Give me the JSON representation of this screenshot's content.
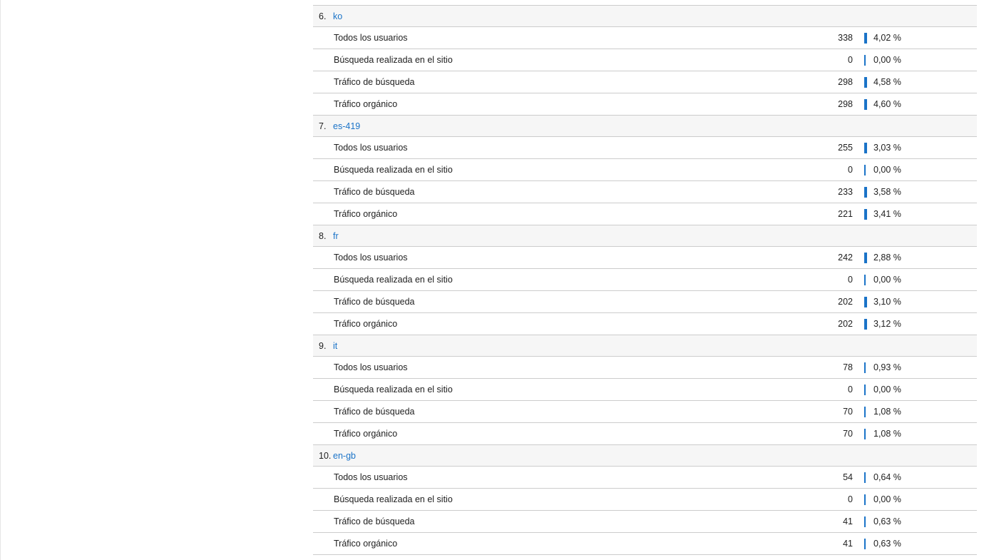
{
  "colors": {
    "accent": "#1a73c8",
    "header_bg": "#f6f6f6",
    "border": "#cccccc"
  },
  "groups": [
    {
      "index": "6.",
      "label": "ko",
      "rows": [
        {
          "label": "Todos los usuarios",
          "value": "338",
          "percent": "4,02 %",
          "pct": 4.02
        },
        {
          "label": "Búsqueda realizada en el sitio",
          "value": "0",
          "percent": "0,00 %",
          "pct": 0
        },
        {
          "label": "Tráfico de búsqueda",
          "value": "298",
          "percent": "4,58 %",
          "pct": 4.58
        },
        {
          "label": "Tráfico orgánico",
          "value": "298",
          "percent": "4,60 %",
          "pct": 4.6
        }
      ]
    },
    {
      "index": "7.",
      "label": "es-419",
      "rows": [
        {
          "label": "Todos los usuarios",
          "value": "255",
          "percent": "3,03 %",
          "pct": 3.03
        },
        {
          "label": "Búsqueda realizada en el sitio",
          "value": "0",
          "percent": "0,00 %",
          "pct": 0
        },
        {
          "label": "Tráfico de búsqueda",
          "value": "233",
          "percent": "3,58 %",
          "pct": 3.58
        },
        {
          "label": "Tráfico orgánico",
          "value": "221",
          "percent": "3,41 %",
          "pct": 3.41
        }
      ]
    },
    {
      "index": "8.",
      "label": "fr",
      "rows": [
        {
          "label": "Todos los usuarios",
          "value": "242",
          "percent": "2,88 %",
          "pct": 2.88
        },
        {
          "label": "Búsqueda realizada en el sitio",
          "value": "0",
          "percent": "0,00 %",
          "pct": 0
        },
        {
          "label": "Tráfico de búsqueda",
          "value": "202",
          "percent": "3,10 %",
          "pct": 3.1
        },
        {
          "label": "Tráfico orgánico",
          "value": "202",
          "percent": "3,12 %",
          "pct": 3.12
        }
      ]
    },
    {
      "index": "9.",
      "label": "it",
      "rows": [
        {
          "label": "Todos los usuarios",
          "value": "78",
          "percent": "0,93 %",
          "pct": 0.93
        },
        {
          "label": "Búsqueda realizada en el sitio",
          "value": "0",
          "percent": "0,00 %",
          "pct": 0
        },
        {
          "label": "Tráfico de búsqueda",
          "value": "70",
          "percent": "1,08 %",
          "pct": 1.08
        },
        {
          "label": "Tráfico orgánico",
          "value": "70",
          "percent": "1,08 %",
          "pct": 1.08
        }
      ]
    },
    {
      "index": "10.",
      "label": "en-gb",
      "rows": [
        {
          "label": "Todos los usuarios",
          "value": "54",
          "percent": "0,64 %",
          "pct": 0.64
        },
        {
          "label": "Búsqueda realizada en el sitio",
          "value": "0",
          "percent": "0,00 %",
          "pct": 0
        },
        {
          "label": "Tráfico de búsqueda",
          "value": "41",
          "percent": "0,63 %",
          "pct": 0.63
        },
        {
          "label": "Tráfico orgánico",
          "value": "41",
          "percent": "0,63 %",
          "pct": 0.63
        }
      ]
    }
  ]
}
